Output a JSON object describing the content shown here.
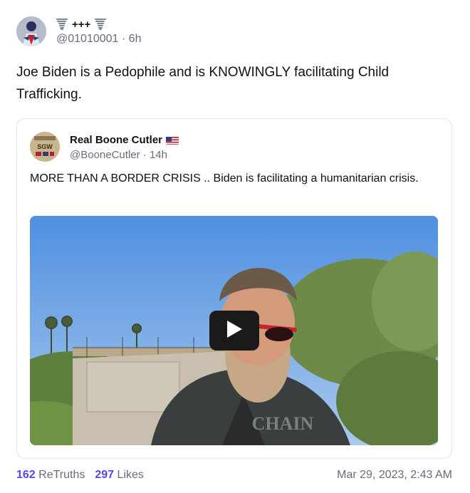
{
  "post": {
    "display_name": "+++",
    "handle": "@01010001",
    "separator": "·",
    "age": "6h",
    "text": "Joe Biden is a Pedophile and is KNOWINGLY facilitating Child Trafficking."
  },
  "quoted_post": {
    "display_name": "Real Boone Cutler",
    "handle": "@BooneCutler",
    "separator": "·",
    "age": "14h",
    "text": "MORE THAN A BORDER CRISIS .. Biden is facilitating a humanitarian crisis.",
    "avatar_text": "SGW",
    "video": {
      "play_icon": "play-icon",
      "shirt_text": "CHAIN"
    }
  },
  "stats": {
    "retruths_count": "162",
    "retruths_label": "ReTruths",
    "likes_count": "297",
    "likes_label": "Likes",
    "timestamp": "Mar 29, 2023, 2:43 AM"
  },
  "colors": {
    "accent": "#5448ee",
    "muted_text": "#6b6b7b",
    "border": "#e4e4ea"
  },
  "icons": [
    "tornado-icon",
    "us-flag-icon",
    "play-icon"
  ]
}
